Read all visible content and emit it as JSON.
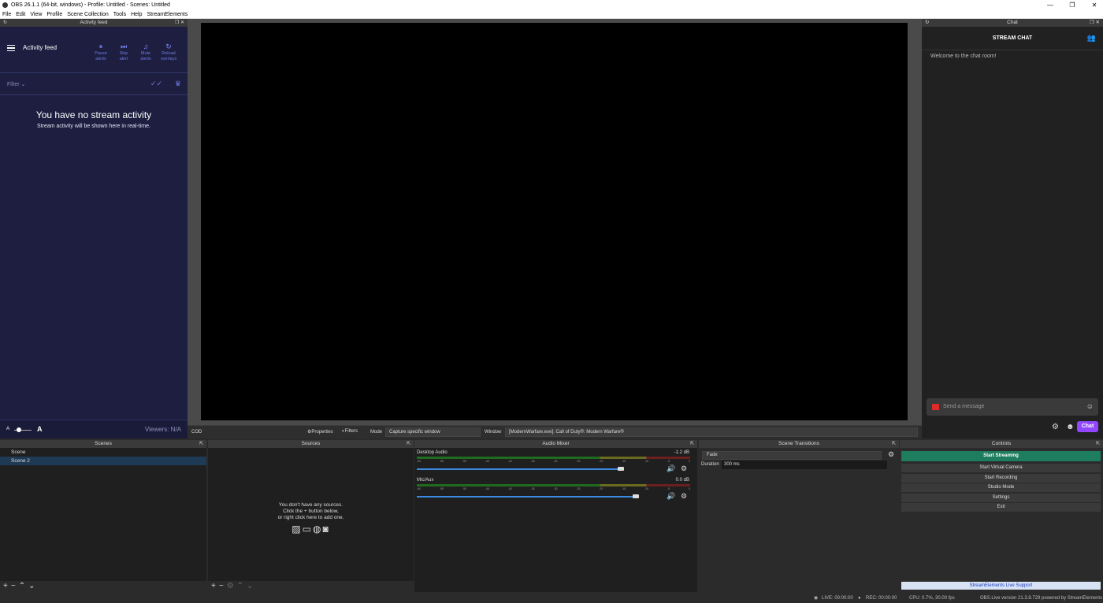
{
  "window": {
    "title": "OBS 26.1.1 (64-bit, windows) - Profile: Untitled - Scenes: Untitled",
    "minimize": "—",
    "maximize": "❐",
    "close": "✕"
  },
  "menu": [
    "File",
    "Edit",
    "View",
    "Profile",
    "Scene Collection",
    "Tools",
    "Help",
    "StreamElements"
  ],
  "activity_feed": {
    "dock_title": "Activity feed",
    "title": "Activity feed",
    "buttons": [
      {
        "icon": "pause-icon",
        "glyph": "⏸",
        "label1": "Pause",
        "label2": "alerts"
      },
      {
        "icon": "skip-icon",
        "glyph": "⏭",
        "label1": "Skip",
        "label2": "alert"
      },
      {
        "icon": "bell-icon",
        "glyph": "🔔",
        "label1": "Mute",
        "label2": "alerts"
      },
      {
        "icon": "reload-icon",
        "glyph": "↻",
        "label1": "Reload",
        "label2": "overlays"
      }
    ],
    "filter": "Filter",
    "empty_title": "You have no stream activity",
    "empty_subtitle": "Stream activity will be shown here in real-time.",
    "font_small": "A",
    "font_large": "A",
    "viewers": "Viewers: N/A"
  },
  "chat": {
    "dock_title": "Chat",
    "title": "STREAM CHAT",
    "welcome": "Welcome to the chat room!",
    "placeholder": "Send a message",
    "chat_button": "Chat"
  },
  "context_bar": {
    "source": "COD",
    "properties": "Properties",
    "filters": "Filters",
    "mode_label": "Mode",
    "mode_value": "Capture specific window",
    "window_label": "Window",
    "window_value": "[ModernWarfare.exe]: Call of Duty®: Modern Warfare®"
  },
  "scenes": {
    "title": "Scenes",
    "items": [
      "Scene",
      "Scene 2"
    ],
    "selected": 1
  },
  "sources": {
    "title": "Sources",
    "empty_line1": "You don't have any sources.",
    "empty_line2": "Click the + button below,",
    "empty_line3": "or right click here to add one."
  },
  "mixer": {
    "title": "Audio Mixer",
    "channels": [
      {
        "name": "Desktop Audio",
        "db": "-1.2 dB",
        "volume": 0.84
      },
      {
        "name": "Mic/Aux",
        "db": "0.0 dB",
        "volume": 0.9
      }
    ],
    "ticks": [
      "-60",
      "-55",
      "-50",
      "-45",
      "-40",
      "-35",
      "-30",
      "-25",
      "-20",
      "-15",
      "-10",
      "-5",
      "0"
    ]
  },
  "transitions": {
    "title": "Scene Transitions",
    "selected": "Fade",
    "duration_label": "Duration",
    "duration_value": "300 ms"
  },
  "controls": {
    "title": "Controls",
    "buttons": [
      "Start Streaming",
      "Start Virtual Camera",
      "Start Recording",
      "Studio Mode",
      "Settings",
      "Exit"
    ],
    "live_support": "StreamElements Live Support"
  },
  "status": {
    "live": "LIVE: 00:00:00",
    "rec": "REC: 00:00:00",
    "cpu": "CPU: 0.7%, 30.00 fps",
    "version": "OBS.Live version 21.3.8.729 powered by StreamElements"
  },
  "colors": {
    "feed_bg": "#1d1e40",
    "accent": "#7d89f5",
    "chat_button": "#9147ff",
    "start_streaming": "#1e7d5e"
  }
}
